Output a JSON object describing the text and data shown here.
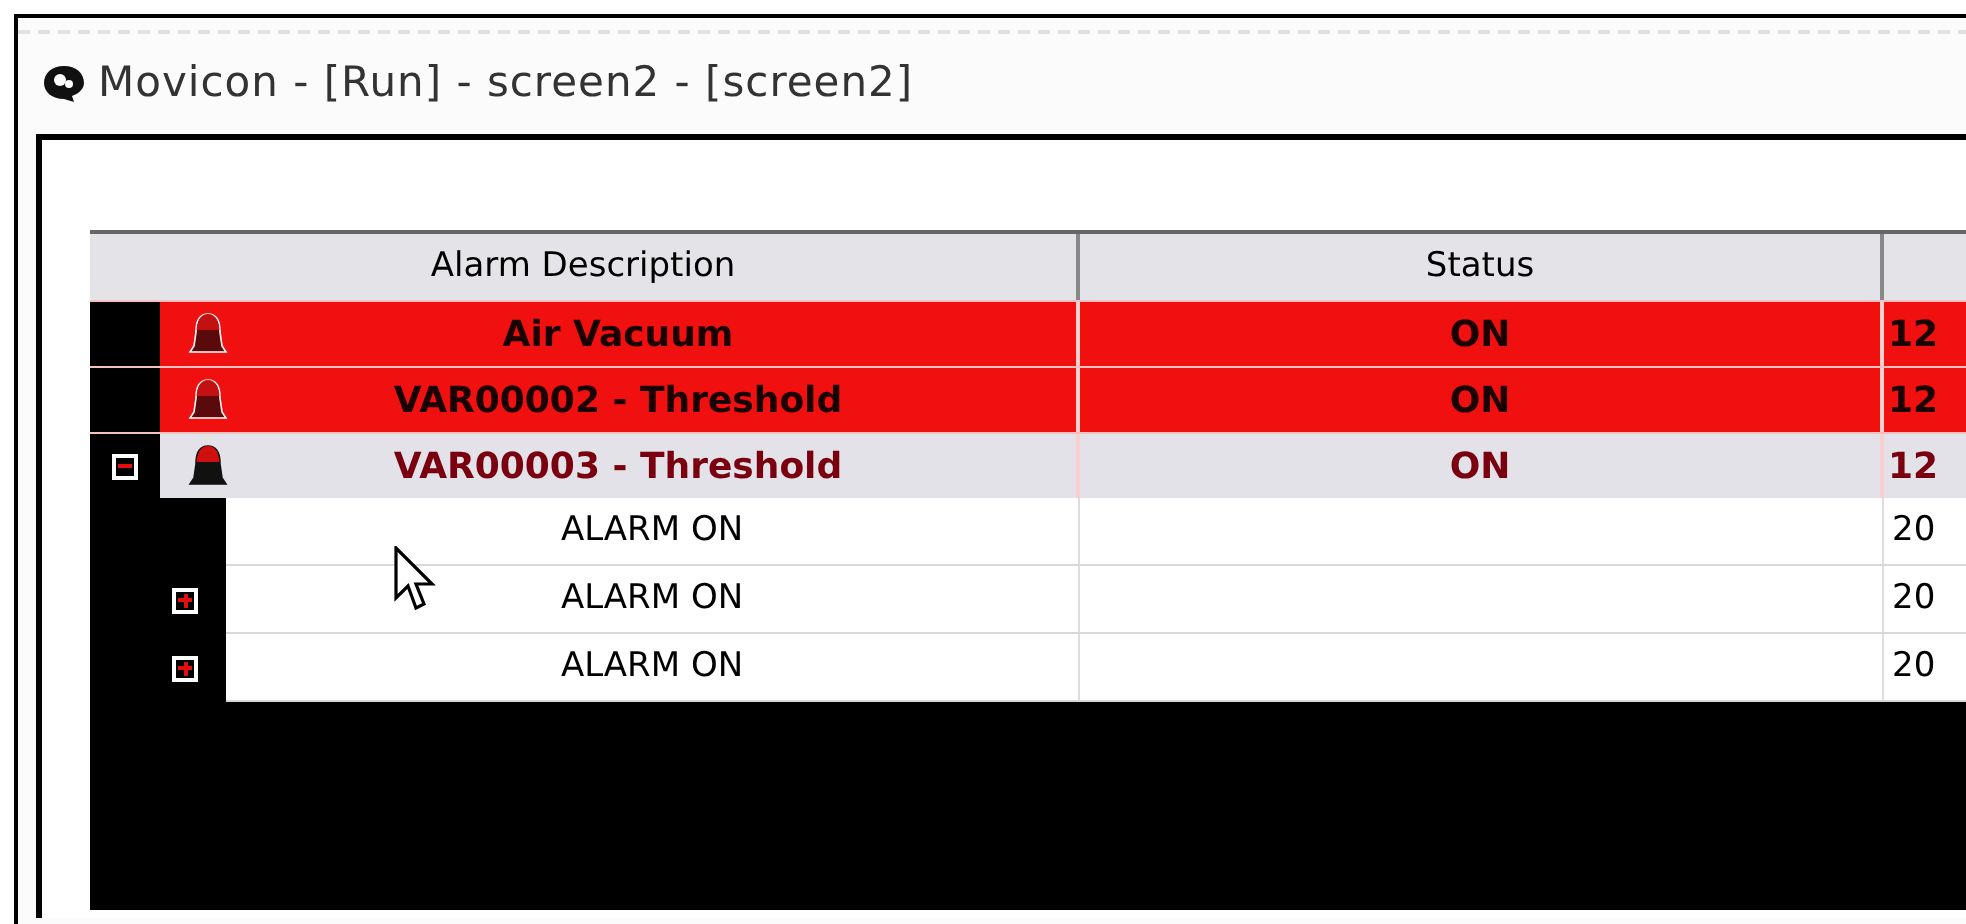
{
  "window": {
    "title": "Movicon - [Run] - screen2 - [screen2]"
  },
  "table": {
    "columns": [
      "Alarm Description",
      "Status"
    ],
    "rows": [
      {
        "description": "Air Vacuum",
        "status": "ON",
        "column_3": "12",
        "active": true
      },
      {
        "description": "VAR00002 - Threshold",
        "status": "ON",
        "column_3": "12",
        "active": true
      },
      {
        "description": "VAR00003 - Threshold",
        "status": "ON",
        "column_3": "12",
        "active": false,
        "expanded": true,
        "children": [
          {
            "description": "ALARM ON",
            "column_3": "20"
          },
          {
            "description": "ALARM ON",
            "column_3": "20",
            "expanded": false
          },
          {
            "description": "ALARM ON",
            "column_3": "20",
            "expanded": false
          }
        ]
      }
    ]
  }
}
